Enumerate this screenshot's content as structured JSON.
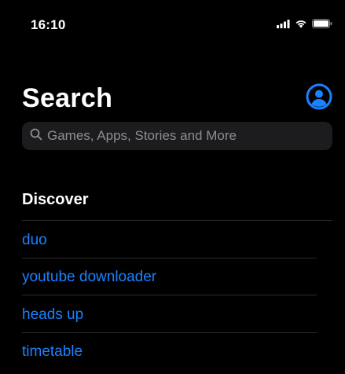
{
  "status_bar": {
    "time": "16:10",
    "icons": [
      "cellular-signal-icon",
      "wifi-icon",
      "battery-icon"
    ]
  },
  "header": {
    "title": "Search",
    "account_icon": "person-circle-icon"
  },
  "search": {
    "placeholder": "Games, Apps, Stories and More",
    "value": ""
  },
  "discover": {
    "title": "Discover",
    "items": [
      {
        "label": "duo"
      },
      {
        "label": "youtube downloader"
      },
      {
        "label": "heads up"
      },
      {
        "label": "timetable"
      }
    ]
  },
  "colors": {
    "background": "#000000",
    "accent": "#1a82ff",
    "search_field": "#1c1c1e",
    "divider": "#2c2c2e",
    "placeholder": "#8e8e93"
  }
}
